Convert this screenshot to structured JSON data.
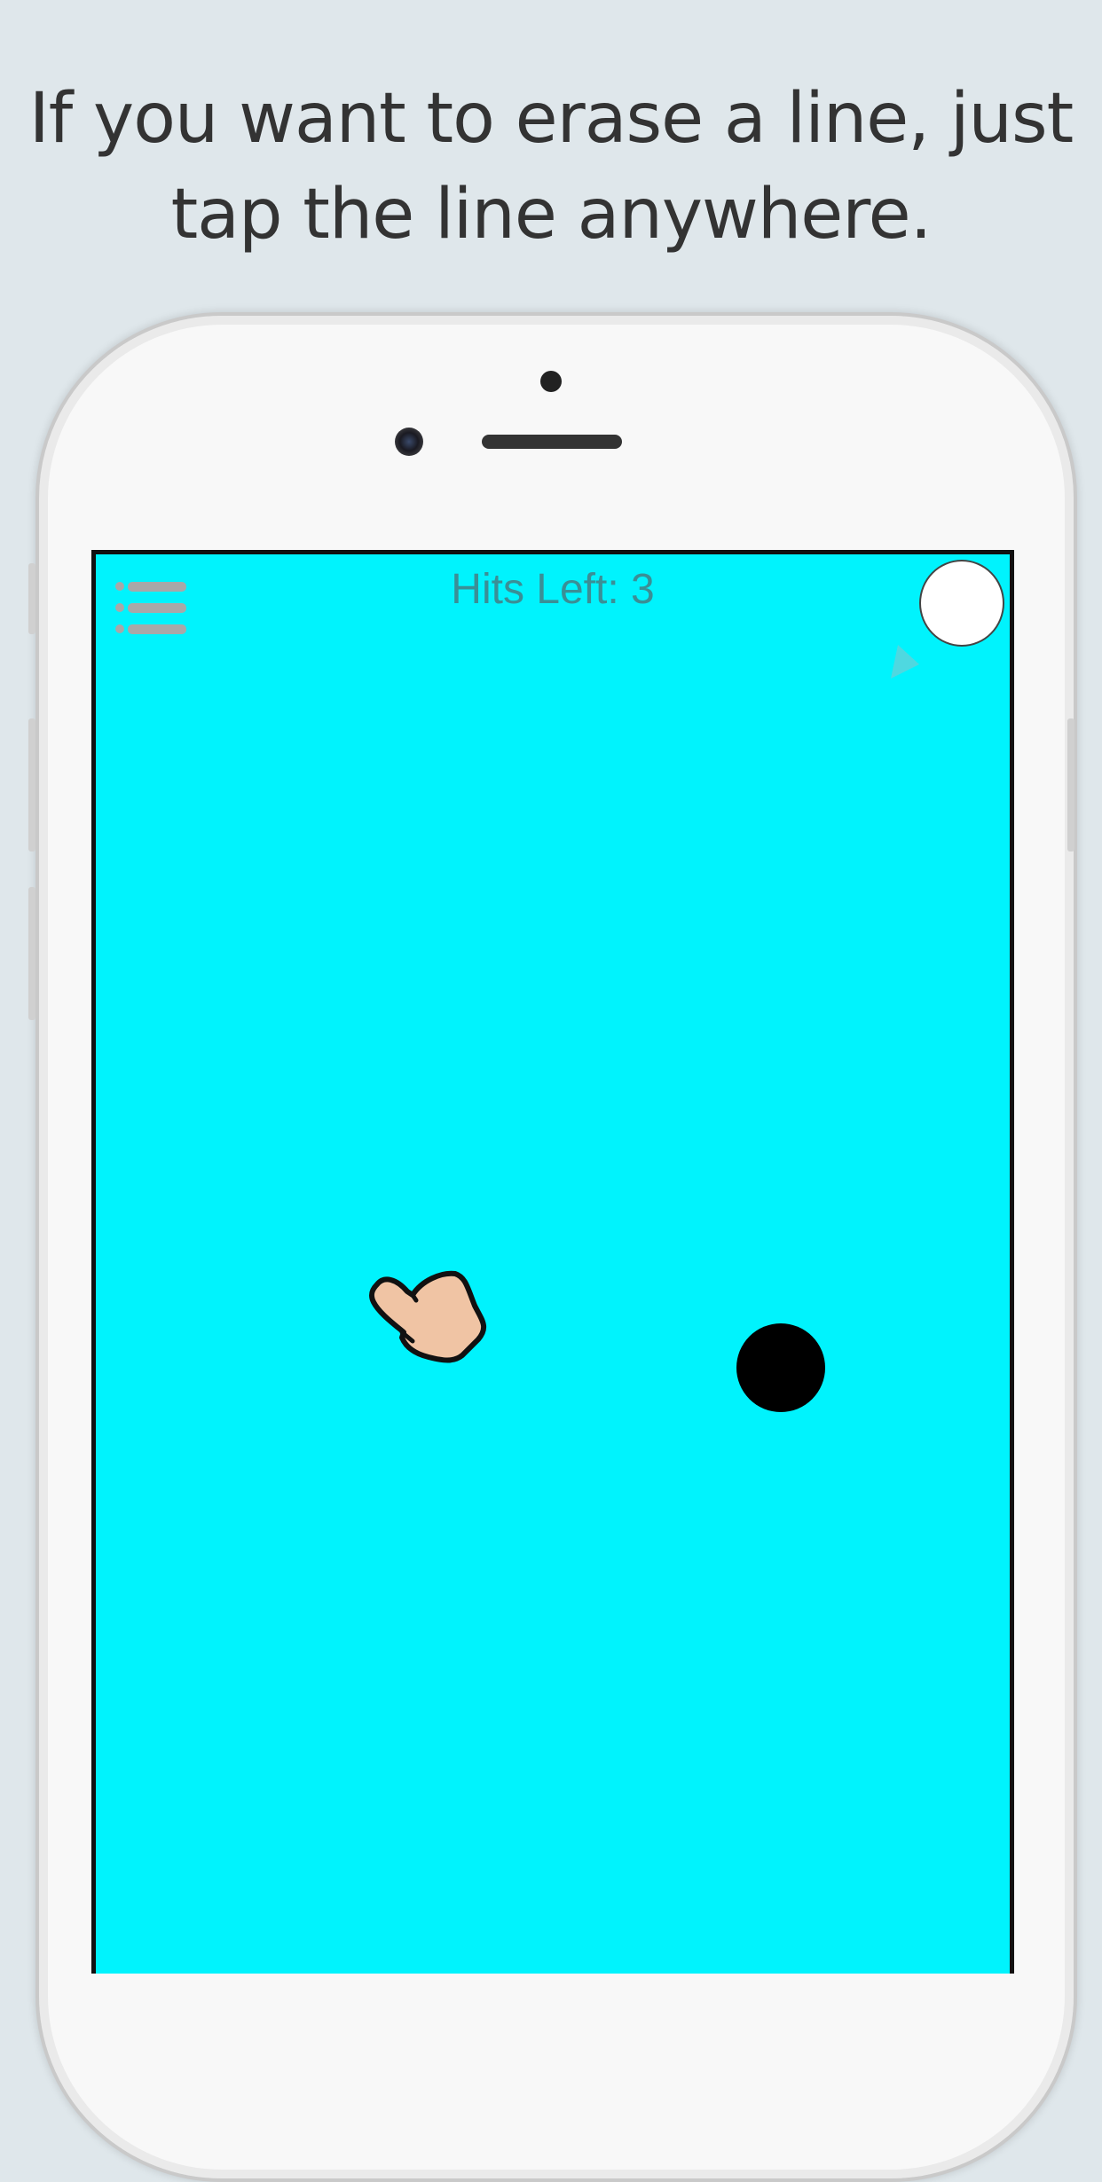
{
  "caption": "If you want to erase a line, just tap the line anywhere.",
  "game": {
    "hits_left": "Hits Left: 3",
    "background_color": "#00f3fd",
    "icons": {
      "menu": "list-menu-icon",
      "action": "white-circle-button",
      "hint": "arrow-pointer-icon",
      "hand": "tap-hand-icon",
      "ball": "black-ball"
    }
  }
}
